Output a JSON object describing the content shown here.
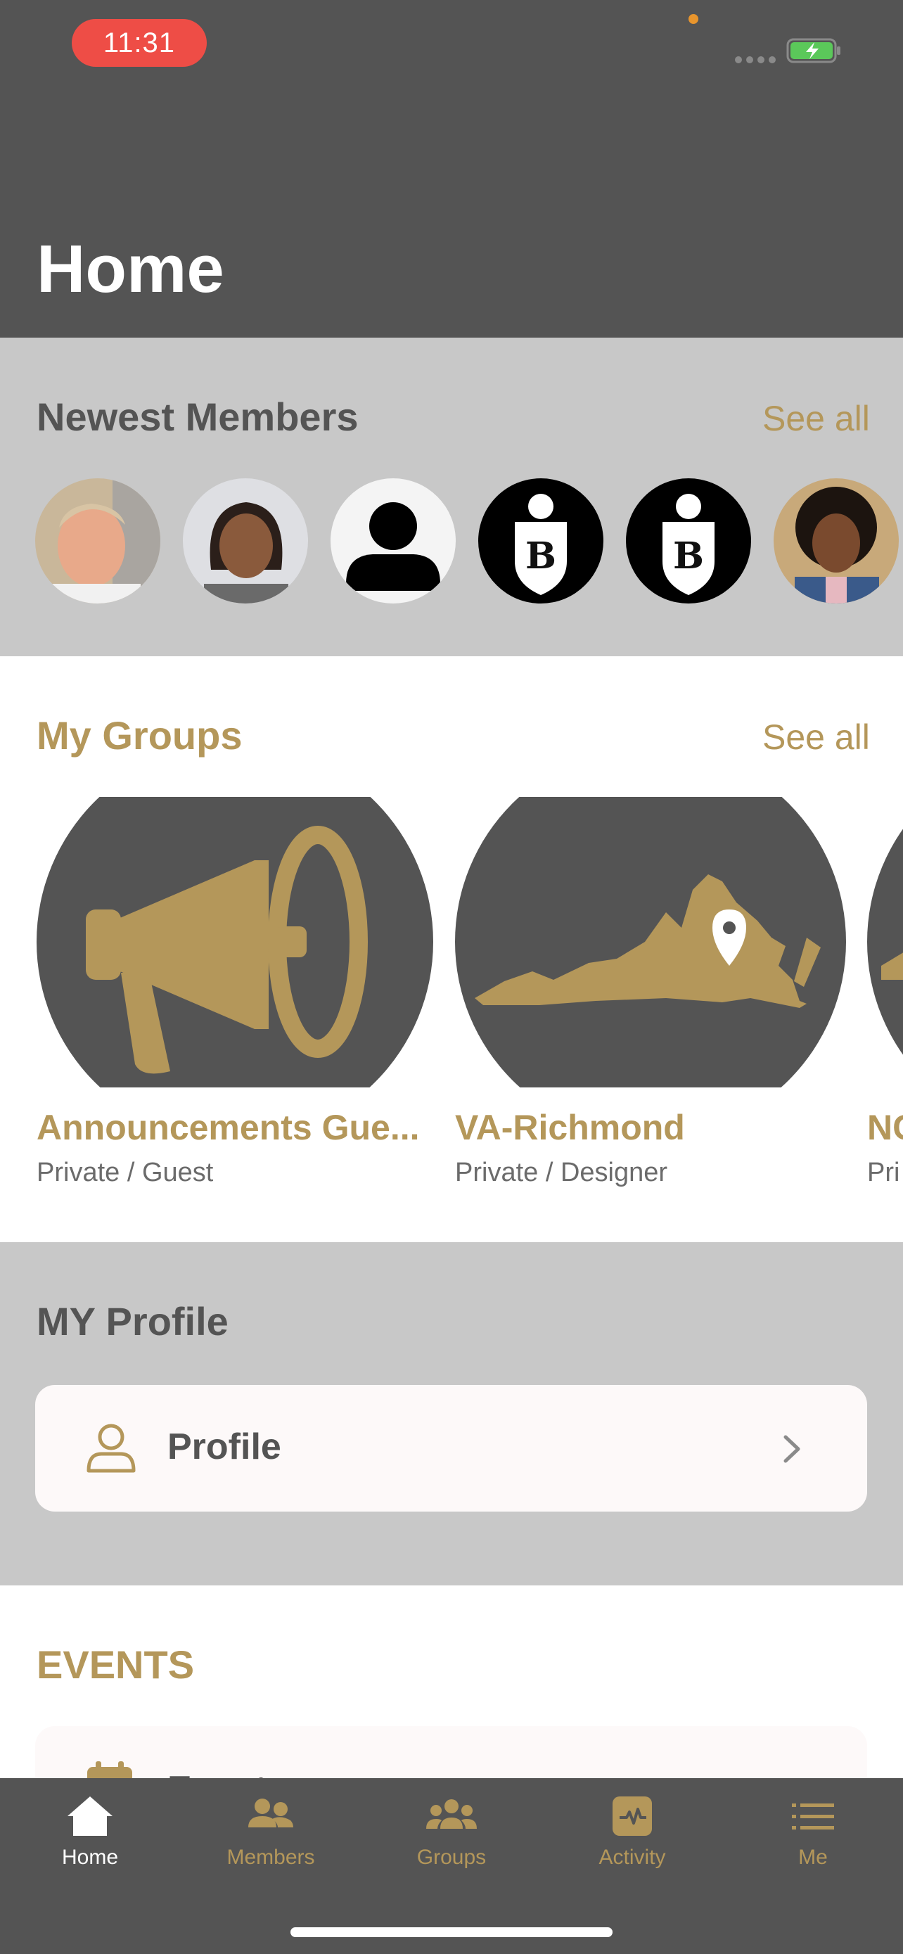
{
  "status_bar": {
    "time": "11:31"
  },
  "header": {
    "title": "Home"
  },
  "newest_members": {
    "title": "Newest Members",
    "see_all": "See all",
    "avatars": [
      "photo-man",
      "photo-woman",
      "default-person",
      "crest-logo",
      "crest-logo",
      "photo-woman-curly"
    ]
  },
  "my_groups": {
    "title": "My Groups",
    "see_all": "See all",
    "items": [
      {
        "name": "Announcements Gue...",
        "subtitle": "Private / Guest",
        "icon": "megaphone-icon"
      },
      {
        "name": "VA-Richmond",
        "subtitle": "Private / Designer",
        "icon": "virginia-map-icon"
      },
      {
        "name": "NC",
        "subtitle": "Pri",
        "icon": "state-map-icon"
      }
    ]
  },
  "my_profile": {
    "title": "MY Profile",
    "item_label": "Profile"
  },
  "events": {
    "title": "EVENTS",
    "item_label": "Events"
  },
  "tabbar": {
    "items": [
      {
        "label": "Home",
        "icon": "home-icon",
        "active": true
      },
      {
        "label": "Members",
        "icon": "members-icon",
        "active": false
      },
      {
        "label": "Groups",
        "icon": "groups-icon",
        "active": false
      },
      {
        "label": "Activity",
        "icon": "activity-icon",
        "active": false
      },
      {
        "label": "Me",
        "icon": "menu-icon",
        "active": false
      }
    ]
  },
  "colors": {
    "header_bg": "#545454",
    "accent_gold": "#b4975a",
    "section_gray": "#c8c8c8",
    "status_red": "#ee4d46"
  }
}
